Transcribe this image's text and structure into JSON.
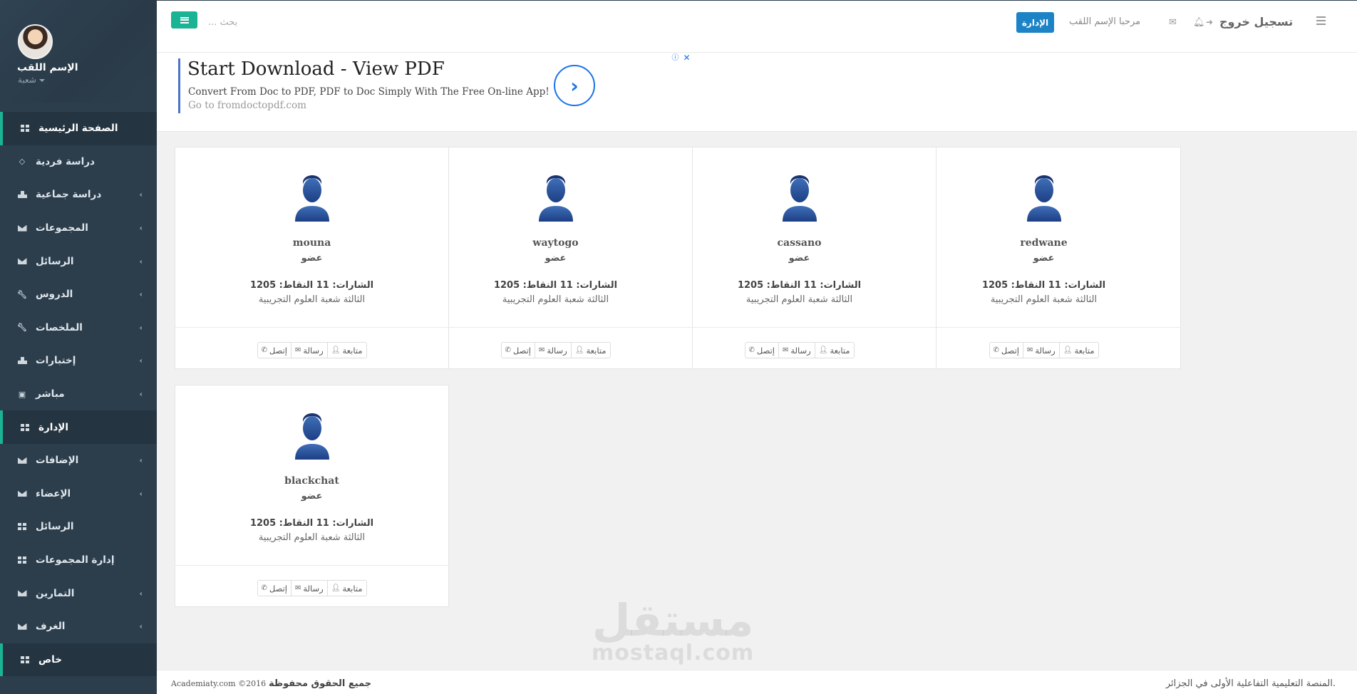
{
  "profile": {
    "name": "الإسم اللقب",
    "sub": "شعبة"
  },
  "nav": [
    {
      "label": "الصفحة الرئيسية",
      "icon": "grid-icon",
      "active": true,
      "chevron": false
    },
    {
      "label": "دراسة فردية",
      "icon": "diamond-icon",
      "active": false,
      "chevron": false
    },
    {
      "label": "دراسة جماعية",
      "icon": "sitemap-icon",
      "active": false,
      "chevron": true
    },
    {
      "label": "المجموعات",
      "icon": "envelope-icon",
      "active": false,
      "chevron": true
    },
    {
      "label": "الرسائل",
      "icon": "envelope-icon",
      "active": false,
      "chevron": true
    },
    {
      "label": "الدروس",
      "icon": "wrench-icon",
      "active": false,
      "chevron": true
    },
    {
      "label": "الملخصات",
      "icon": "wrench-icon",
      "active": false,
      "chevron": true
    },
    {
      "label": "إختبارات",
      "icon": "sitemap-icon",
      "active": false,
      "chevron": true
    },
    {
      "label": "مباشر",
      "icon": "video-icon",
      "active": false,
      "chevron": true
    },
    {
      "label": "الإدارة",
      "icon": "grid-icon",
      "active": true,
      "chevron": false
    },
    {
      "label": "الإضافات",
      "icon": "envelope-icon",
      "active": false,
      "chevron": true
    },
    {
      "label": "الإعضاء",
      "icon": "envelope-icon",
      "active": false,
      "chevron": true
    },
    {
      "label": "الرسائل",
      "icon": "grid-icon",
      "active": false,
      "chevron": false
    },
    {
      "label": "إدارة المجموعات",
      "icon": "grid-icon",
      "active": false,
      "chevron": false
    },
    {
      "label": "التمارين",
      "icon": "envelope-icon",
      "active": false,
      "chevron": true
    },
    {
      "label": "الغرف",
      "icon": "envelope-icon",
      "active": false,
      "chevron": true
    },
    {
      "label": "خاص",
      "icon": "grid-icon",
      "active": true,
      "chevron": false
    }
  ],
  "header": {
    "search_placeholder": "بحث ...",
    "admin_button": "الإدارة",
    "welcome": "مرحبا الإسم اللقب",
    "logout": "تسجيل خروج"
  },
  "ad": {
    "title": "Start Download - View PDF",
    "description": "Convert From Doc to PDF, PDF to Doc Simply With The Free On-line App!",
    "link": "Go to fromdoctopdf.com"
  },
  "members": [
    {
      "name": "redwane",
      "role": "عضو",
      "stats": "الشارات: 11 النقاط: 1205",
      "class": "الثالثة شعبة العلوم التجريبية"
    },
    {
      "name": "cassano",
      "role": "عضو",
      "stats": "الشارات: 11 النقاط: 1205",
      "class": "الثالثة شعبة العلوم التجريبية"
    },
    {
      "name": "waytogo",
      "role": "عضو",
      "stats": "الشارات: 11 النقاط: 1205",
      "class": "الثالثة شعبة العلوم التجريبية"
    },
    {
      "name": "mouna",
      "role": "عضو",
      "stats": "الشارات: 11 النقاط: 1205",
      "class": "الثالثة شعبة العلوم التجريبية"
    },
    {
      "name": "blackchat",
      "role": "عضو",
      "stats": "الشارات: 11 النقاط: 1205",
      "class": "الثالثة شعبة العلوم التجريبية"
    }
  ],
  "card_actions": {
    "follow": "متابعة",
    "message": "رسالة",
    "contact": "إتصل"
  },
  "footer": {
    "left_site": "Academiaty.com ©2016",
    "left_rights": "جميع الحقوق محفوظة",
    "right_text": "المنصة التعليمية التفاعلية الأولى في الجزائر."
  },
  "watermark": {
    "arabic": "مستقل",
    "latin": "mostaql.com"
  },
  "colors": {
    "accent": "#1ab394",
    "primary": "#1c84c6",
    "sidebar": "#2c3e4c"
  }
}
